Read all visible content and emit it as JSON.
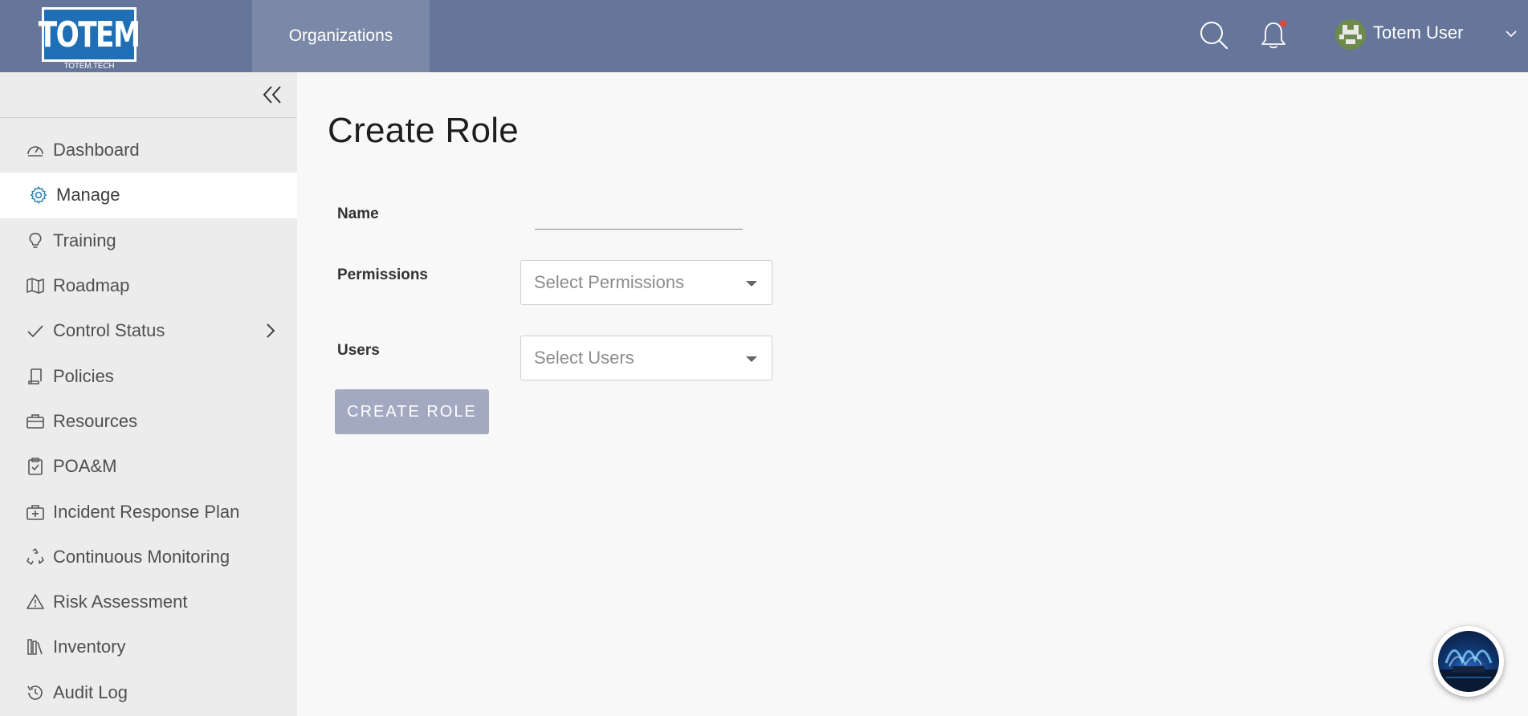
{
  "topbar": {
    "logo_text": "TOTEM",
    "logo_subtext": "TOTEM.TECH",
    "nav_organizations": "Organizations",
    "user_name": "Totem User",
    "bg_color": "#65769a"
  },
  "sidebar": {
    "items": [
      {
        "label": "Dashboard",
        "icon": "gauge-icon"
      },
      {
        "label": "Manage",
        "icon": "gear-icon",
        "active": true
      },
      {
        "label": "Training",
        "icon": "lightbulb-icon"
      },
      {
        "label": "Roadmap",
        "icon": "map-icon"
      },
      {
        "label": "Control Status",
        "icon": "check-icon",
        "has_submenu": true
      },
      {
        "label": "Policies",
        "icon": "scroll-icon"
      },
      {
        "label": "Resources",
        "icon": "briefcase-icon"
      },
      {
        "label": "POA&M",
        "icon": "clipboard-check-icon"
      },
      {
        "label": "Incident Response Plan",
        "icon": "medkit-icon"
      },
      {
        "label": "Continuous Monitoring",
        "icon": "recycle-icon"
      },
      {
        "label": "Risk Assessment",
        "icon": "warning-icon"
      },
      {
        "label": "Inventory",
        "icon": "books-icon"
      },
      {
        "label": "Audit Log",
        "icon": "history-icon"
      }
    ]
  },
  "main": {
    "title": "Create Role",
    "name_label": "Name",
    "name_value": "",
    "permissions_label": "Permissions",
    "permissions_placeholder": "Select Permissions",
    "users_label": "Users",
    "users_placeholder": "Select Users",
    "create_button": "CREATE ROLE"
  }
}
